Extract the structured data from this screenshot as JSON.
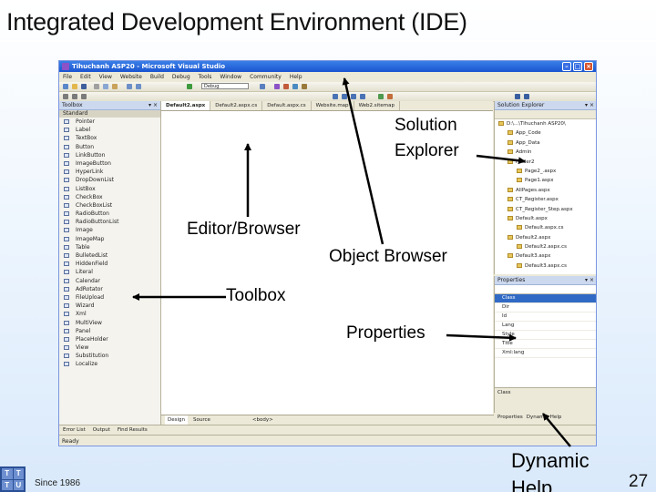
{
  "slide": {
    "title": "Integrated Development Environment (IDE)",
    "footer_since": "Since 1986",
    "logo_letters": [
      "T",
      "T",
      "T",
      "U"
    ],
    "page_number": "27"
  },
  "callouts": {
    "solution_explorer_line1": "Solution",
    "solution_explorer_line2": "Explorer",
    "editor_browser": "Editor/Browser",
    "object_browser": "Object Browser",
    "toolbox": "Toolbox",
    "properties": "Properties",
    "dynamic_help_line1": "Dynamic",
    "dynamic_help_line2": "Help"
  },
  "ide": {
    "window_title": "Tihuchanh ASP20 - Microsoft Visual Studio",
    "menu": [
      "File",
      "Edit",
      "View",
      "Website",
      "Build",
      "Debug",
      "Tools",
      "Window",
      "Community",
      "Help"
    ],
    "config_select": "Debug",
    "toolbox": {
      "header": "Toolbox",
      "section": "Standard",
      "items": [
        "Pointer",
        "Label",
        "TextBox",
        "Button",
        "LinkButton",
        "ImageButton",
        "HyperLink",
        "DropDownList",
        "ListBox",
        "CheckBox",
        "CheckBoxList",
        "RadioButton",
        "RadioButtonList",
        "Image",
        "ImageMap",
        "Table",
        "BulletedList",
        "HiddenField",
        "Literal",
        "Calendar",
        "AdRotator",
        "FileUpload",
        "Wizard",
        "Xml",
        "MultiView",
        "Panel",
        "PlaceHolder",
        "View",
        "Substitution",
        "Localize"
      ]
    },
    "editor": {
      "tabs": [
        "Default2.aspx",
        "Default2.aspx.cs",
        "Default.aspx.cs",
        "Website.map",
        "Web2.sitemap"
      ],
      "design_tabs": [
        "Design",
        "Source"
      ],
      "breadcrumb": "<body>"
    },
    "solution_explorer": {
      "header": "Solution Explorer",
      "tree": [
        "D:\\...\\Tihuchanh ASP20\\",
        "App_Code",
        "App_Data",
        "Admin",
        "Folder2",
        "Page2_.aspx",
        "Page1.aspx",
        "AllPages.aspx",
        "CT_Register.aspx",
        "CT_Register_Step.aspx",
        "Default.aspx",
        "Default.aspx.cs",
        "Default2.aspx",
        "Default2.aspx.cs",
        "Default3.aspx",
        "Default3.aspx.cs"
      ]
    },
    "properties": {
      "header": "Properties",
      "rows": [
        "Class",
        "Dir",
        "Id",
        "Lang",
        "Style",
        "Title",
        "Xml:lang"
      ],
      "description": "Class"
    },
    "right_tabs": [
      "Properties",
      "Dynamic Help"
    ],
    "bottom_tabs": [
      "Error List",
      "Output",
      "Find Results"
    ],
    "status": "Ready"
  }
}
